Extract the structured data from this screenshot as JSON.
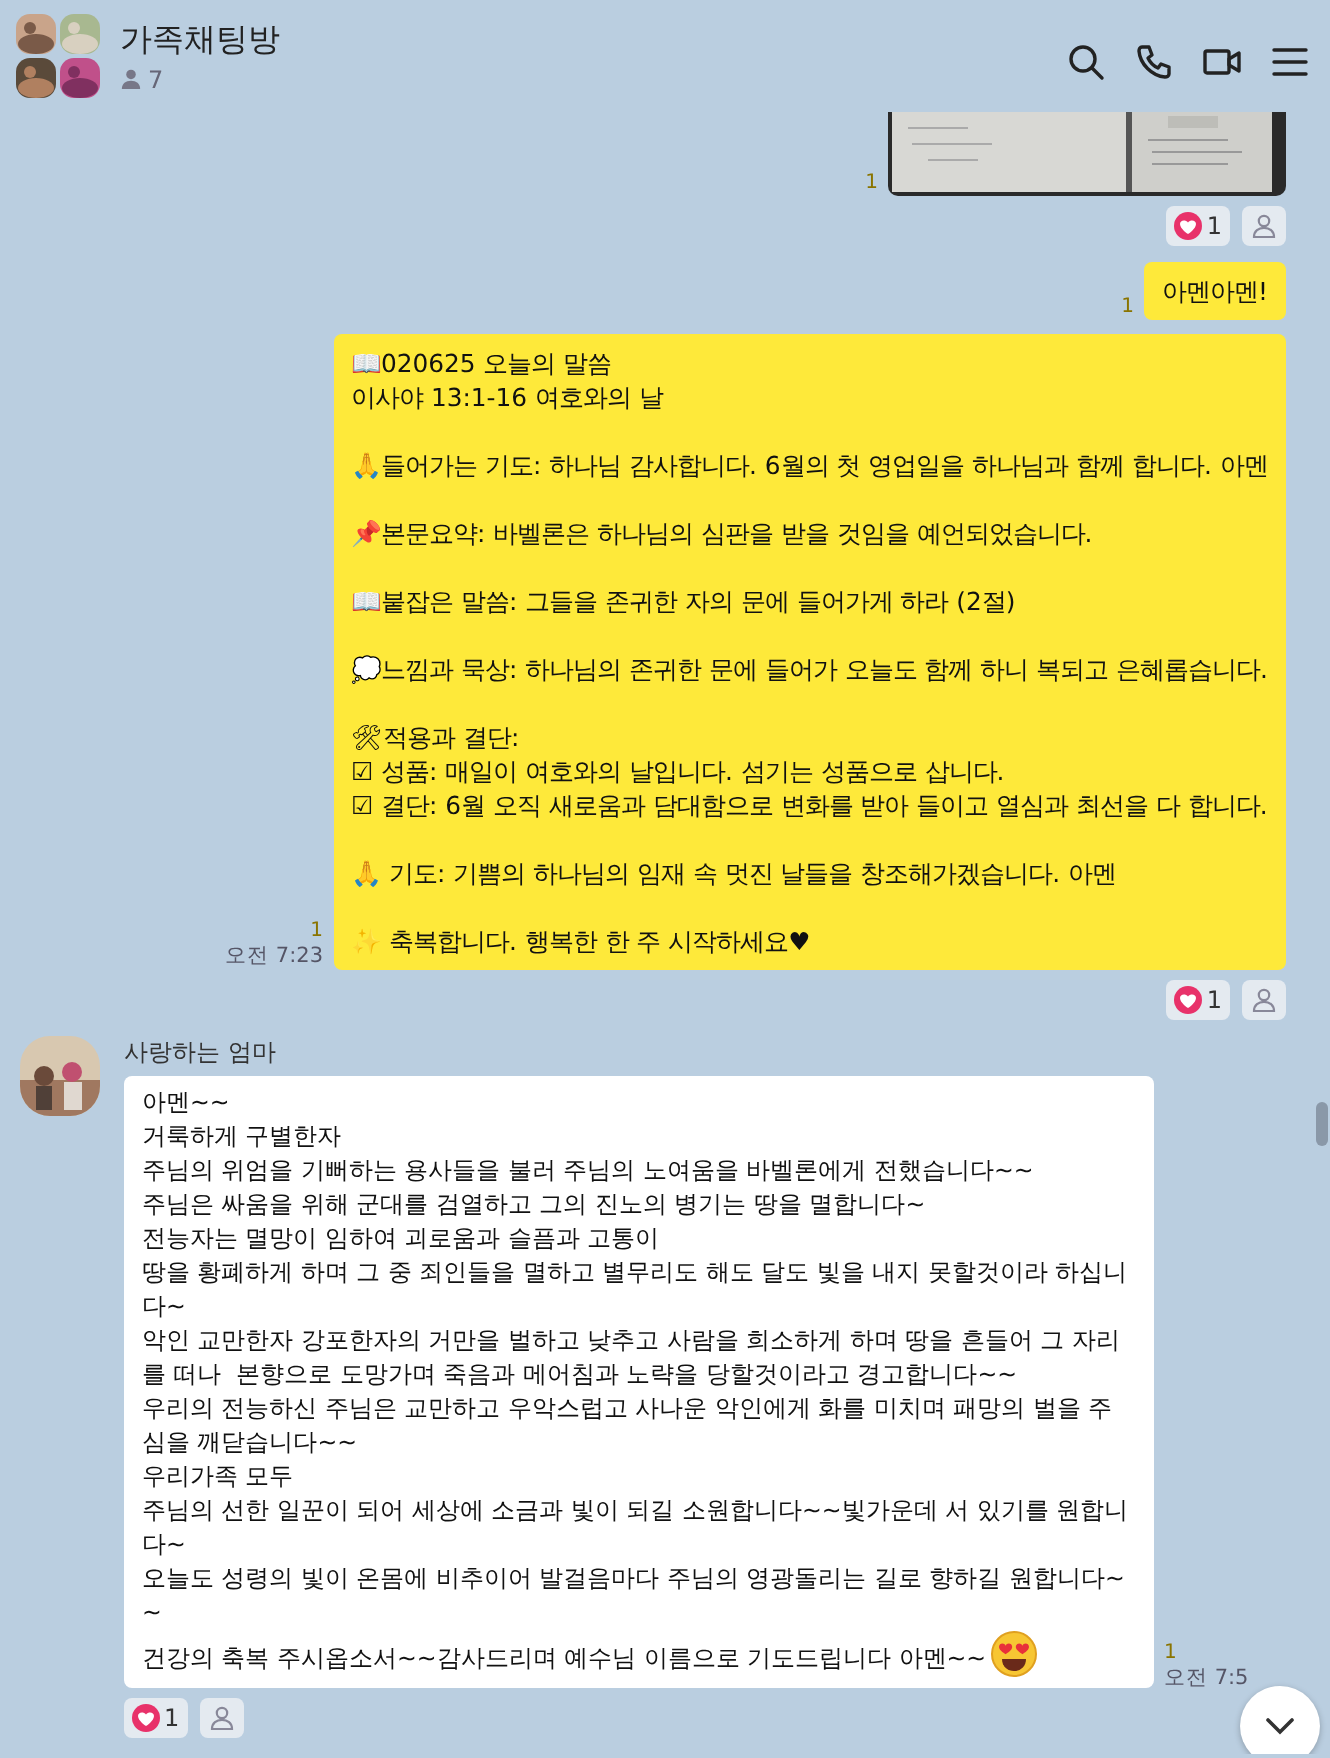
{
  "header": {
    "title": "가족채팅방",
    "member_count": "7"
  },
  "messages": [
    {
      "kind": "picture",
      "unread": "1",
      "reactions": {
        "heart_count": "1"
      }
    },
    {
      "kind": "text",
      "text": "아멘아멘!",
      "unread": "1"
    },
    {
      "kind": "text",
      "text": "📖020625 오늘의 말씀\n이사야 13:1-16 여호와의 날\n\n🙏들어가는 기도: 하나님 감사합니다. 6월의 첫 영업일을 하나님과 함께 합니다. 아멘\n\n📌본문요약: 바벨론은 하나님의 심판을 받을 것임을 예언되었습니다.\n\n📖붙잡은 말씀: 그들을 존귀한 자의 문에 들어가게 하라 (2절)\n\n💭느낌과 묵상: 하나님의 존귀한 문에 들어가 오늘도 함께 하니 복되고 은혜롭습니다.\n\n🛠적용과 결단:\n☑ 성품: 매일이 여호와의 날입니다. 섬기는 성품으로 삽니다.\n☑ 결단: 6월 오직 새로움과 담대함으로 변화를 받아 들이고 열심과 최선을 다 합니다.\n\n🙏 기도: 기쁨의 하나님의 임재 속 멋진 날들을 창조해가겠습니다. 아멘\n\n✨ 축복합니다. 행복한 한 주 시작하세요♥",
      "unread": "1",
      "time": "오전 7:23",
      "reactions": {
        "heart_count": "1"
      }
    },
    {
      "kind": "text",
      "sender": "사랑하는 엄마",
      "text": "아멘~~\n거룩하게 구별한자\n주님의 위엄을 기뻐하는 용사들을 불러 주님의 노여움을 바벨론에게 전했습니다~~\n주님은 싸움을 위해 군대를 검열하고 그의 진노의 병기는 땅을 멸합니다~\n전능자는 멸망이 임하여 괴로움과 슬픔과 고통이\n땅을 황폐하게 하며 그 중 죄인들을 멸하고 별무리도 해도 달도 빛을 내지 못할것이라 하십니다~\n악인 교만한자 강포한자의 거만을 벌하고 낮추고 사람을 희소하게 하며 땅을 흔들어 그 자리를 떠나  본향으로 도망가며 죽음과 메어침과 노략을 당할것이라고 경고합니다~~\n우리의 전능하신 주님은 교만하고 우악스럽고 사나운 악인에게 화를 미치며 패망의 벌을 주심을 깨닫습니다~~\n우리가족 모두\n주님의 선한 일꾼이 되어 세상에 소금과 빛이 되길 소원합니다~~빛가운데 서 있기를 원합니다~\n오늘도 성령의 빛이 온몸에 비추이어 발걸음마다 주님의 영광돌리는 길로 향하길 원합니다~~\n건강의 축복 주시옵소서~~감사드리며 예수님 이름으로 기도드립니다 아멘~~",
      "unread": "1",
      "time": "오전 7:5",
      "reactions": {
        "heart_count": "1"
      }
    }
  ]
}
